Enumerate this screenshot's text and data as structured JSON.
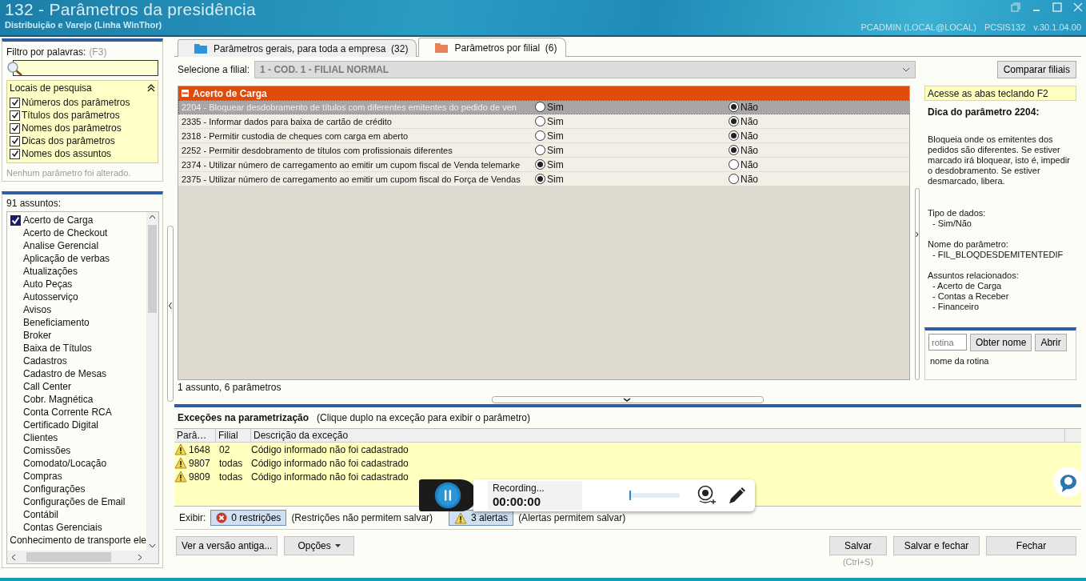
{
  "window": {
    "title": "132 - Parâmetros da presidência",
    "subtitle": "Distribuição e Varejo (Linha WinThor)",
    "user": "PCADMIN (LOCAL@LOCAL)",
    "program": "PCSIS132",
    "version": "v.30.1.04.00"
  },
  "filter": {
    "label": "Filtro por palavras:",
    "shortcut": "(F3)",
    "search_places": {
      "title": "Locais de pesquisa",
      "expanded": true,
      "options": [
        {
          "label": "Números dos parâmetros",
          "checked": true
        },
        {
          "label": "Títulos dos parâmetros",
          "checked": true
        },
        {
          "label": "Nomes dos parâmetros",
          "checked": true
        },
        {
          "label": "Dicas dos parâmetros",
          "checked": true
        },
        {
          "label": "Nomes dos assuntos",
          "checked": true
        }
      ]
    },
    "status": "Nenhum parâmetro foi alterado."
  },
  "subjects": {
    "count_label": "91 assuntos:",
    "items": [
      {
        "label": "Acerto de Carga",
        "checked": true
      },
      {
        "label": "Acerto de Checkout",
        "checked": false
      },
      {
        "label": "Analise Gerencial",
        "checked": false
      },
      {
        "label": "Aplicação de verbas",
        "checked": false
      },
      {
        "label": "Atualizações",
        "checked": false
      },
      {
        "label": "Auto Peças",
        "checked": false
      },
      {
        "label": "Autosserviço",
        "checked": false
      },
      {
        "label": "Avisos",
        "checked": false
      },
      {
        "label": "Beneficiamento",
        "checked": false
      },
      {
        "label": "Broker",
        "checked": false
      },
      {
        "label": "Baixa de Títulos",
        "checked": false
      },
      {
        "label": "Cadastros",
        "checked": false
      },
      {
        "label": "Cadastro de Mesas",
        "checked": false
      },
      {
        "label": "Call Center",
        "checked": false
      },
      {
        "label": "Cobr. Magnética",
        "checked": false
      },
      {
        "label": "Conta Corrente RCA",
        "checked": false
      },
      {
        "label": "Certificado Digital",
        "checked": false
      },
      {
        "label": "Clientes",
        "checked": false
      },
      {
        "label": "Comissões",
        "checked": false
      },
      {
        "label": "Comodato/Locação",
        "checked": false
      },
      {
        "label": "Compras",
        "checked": false
      },
      {
        "label": "Configurações",
        "checked": false
      },
      {
        "label": "Configurações de Email",
        "checked": false
      },
      {
        "label": "Contábil",
        "checked": false
      },
      {
        "label": "Contas Gerenciais",
        "checked": false
      },
      {
        "label": "Conhecimento de transporte ele",
        "checked": false
      }
    ]
  },
  "tabs": [
    {
      "label": "Parâmetros gerais, para toda a empresa",
      "count": "(32)",
      "selected": false,
      "color": "#2f95d6"
    },
    {
      "label": "Parâmetros por filial",
      "count": "(6)",
      "selected": true,
      "color": "#e8805a"
    }
  ],
  "branch": {
    "label": "Selecione a filial:",
    "value": "1 - COD. 1 - FILIAL NORMAL",
    "disabled": true
  },
  "compare_button": "Comparar filiais",
  "groups": [
    {
      "title": "Acerto de Carga",
      "expanded": true,
      "params": [
        {
          "label": "2204 - Bloquear desdobramento de títulos com diferentes emitentes do pedido de ven",
          "selected": true,
          "options": [
            {
              "label": "Sim",
              "selected": false
            },
            {
              "label": "Não",
              "selected": true
            }
          ]
        },
        {
          "label": "2335 - Informar dados para baixa de cartão de crédito",
          "selected": false,
          "options": [
            {
              "label": "Sim",
              "selected": false
            },
            {
              "label": "Não",
              "selected": true
            }
          ]
        },
        {
          "label": "2318 - Permitir custodia de cheques com carga em aberto",
          "selected": false,
          "options": [
            {
              "label": "Sim",
              "selected": false
            },
            {
              "label": "Não",
              "selected": true
            }
          ]
        },
        {
          "label": "2252 - Permitir desdobramento de títulos com profissionais diferentes",
          "selected": false,
          "options": [
            {
              "label": "Sim",
              "selected": false
            },
            {
              "label": "Não",
              "selected": true
            }
          ]
        },
        {
          "label": "2374 - Utilizar número de carregamento ao emitir um cupom fiscal de Venda telemarke",
          "selected": false,
          "options": [
            {
              "label": "Sim",
              "selected": true
            },
            {
              "label": "Não",
              "selected": false
            }
          ]
        },
        {
          "label": "2375 - Utilizar número de carregamento ao emitir um cupom fiscal do Força de Vendas",
          "selected": false,
          "options": [
            {
              "label": "Sim",
              "selected": true
            },
            {
              "label": "Não",
              "selected": false
            }
          ]
        }
      ]
    }
  ],
  "grid_status": "1 assunto, 6 parâmetros",
  "help": {
    "hint": "Acesse as abas teclando F2",
    "heading": "Dica do parâmetro 2204:",
    "description": "Bloqueia onde os emitentes dos pedidos são diferentes. Se estiver marcado irá bloquear, isto é, impedir o desdobramento. Se estiver desmarcado, libera.",
    "sections": [
      {
        "title": "Tipo de dados:",
        "items": [
          "- Sim/Não"
        ]
      },
      {
        "title": "Nome do parâmetro:",
        "items": [
          "- FIL_BLOQDESDEMITENTEDIF"
        ]
      },
      {
        "title": "Assuntos relacionados:",
        "items": [
          "- Acerto de Carga",
          "- Contas a Receber",
          "- Financeiro"
        ]
      }
    ],
    "routine": {
      "placeholder": "rotina",
      "buttons": [
        "Obter nome",
        "Abrir"
      ],
      "name": "nome da rotina"
    }
  },
  "exceptions": {
    "title": "Exceções na parametrização",
    "note": "(Clique duplo na exceção para exibir o parâmetro)",
    "columns": [
      "Parâ…",
      "Filial",
      "Descrição da exceção"
    ],
    "rows": [
      {
        "kind": "alert",
        "parameter": "1648",
        "branch": "02",
        "description": "Código informado não foi cadastrado"
      },
      {
        "kind": "alert",
        "parameter": "9807",
        "branch": "todas",
        "description": "Código informado não foi cadastrado"
      },
      {
        "kind": "alert",
        "parameter": "9809",
        "branch": "todas",
        "description": "Código informado não foi cadastrado"
      }
    ],
    "show_label": "Exibir:",
    "filters": [
      {
        "kind": "restriction",
        "label": "0 restrições",
        "note": "(Restrições não permitem salvar)",
        "selected": true
      },
      {
        "kind": "alert",
        "label": "3 alertas",
        "note": "(Alertas permitem salvar)",
        "selected": true
      }
    ]
  },
  "footer": {
    "left_buttons": [
      {
        "label": "Ver a versão antiga...",
        "kind": "plain"
      },
      {
        "label": "Opções",
        "kind": "menu"
      }
    ],
    "right_buttons": [
      {
        "label": "Salvar",
        "shortcut": "(Ctrl+S)"
      },
      {
        "label": "Salvar e fechar"
      },
      {
        "label": "Fechar"
      }
    ]
  },
  "recorder": {
    "status": "Recording...",
    "time": "00:00:00",
    "level": 0.02
  }
}
